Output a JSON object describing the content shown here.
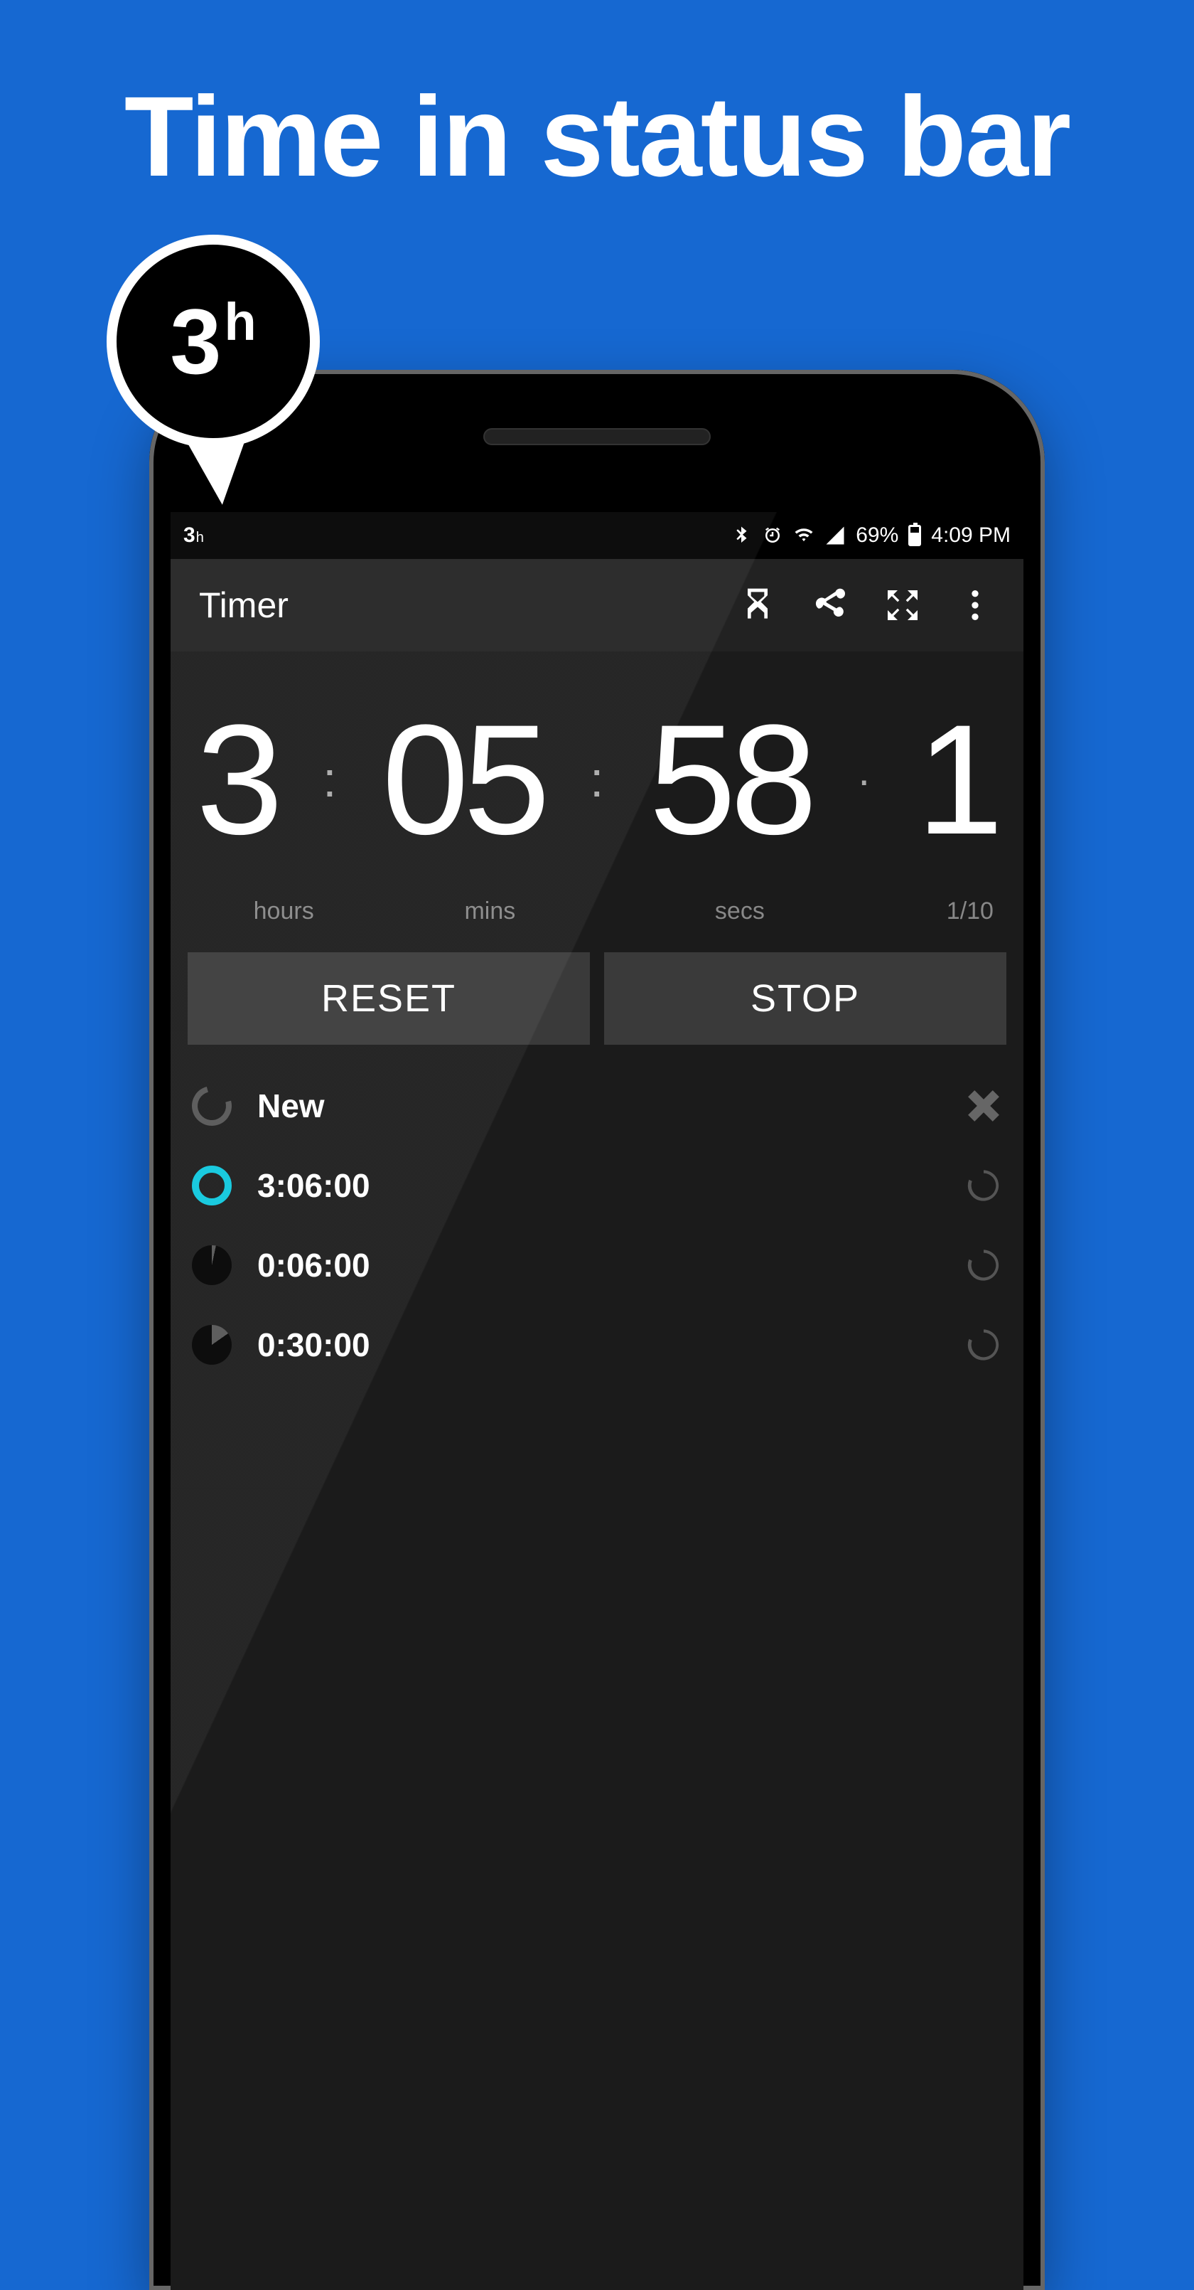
{
  "headline": "Time in status bar",
  "callout": {
    "value": "3",
    "unit": "h"
  },
  "statusbar": {
    "left_value": "3",
    "left_unit": "h",
    "battery_percent": "69%",
    "time": "4:09 PM"
  },
  "appbar": {
    "title": "Timer"
  },
  "timer": {
    "hours": "3",
    "mins": "05",
    "secs": "58",
    "tenths": "1",
    "label_hours": "hours",
    "label_mins": "mins",
    "label_secs": "secs",
    "label_tenths": "1/10"
  },
  "buttons": {
    "left": "RESET",
    "right": "STOP"
  },
  "list": {
    "items": [
      {
        "label": "New"
      },
      {
        "label": "3:06:00"
      },
      {
        "label": "0:06:00"
      },
      {
        "label": "0:30:00"
      }
    ]
  }
}
